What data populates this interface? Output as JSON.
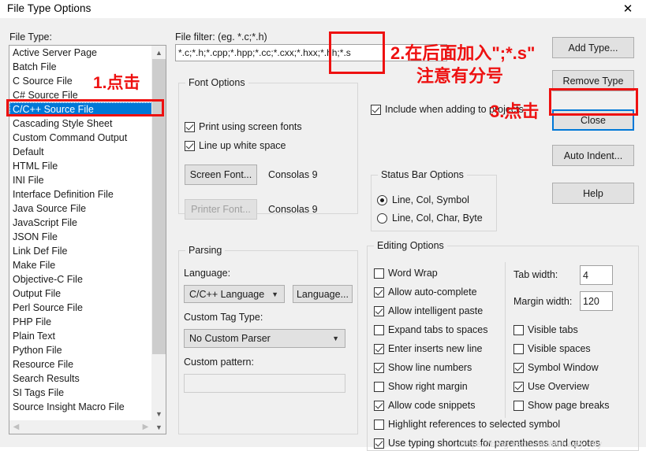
{
  "window": {
    "title": "File Type Options",
    "close_icon": "close-x-icon"
  },
  "filetype": {
    "label": "File Type:",
    "items": [
      "Active Server Page",
      "Batch File",
      "C Source File",
      "C# Source File",
      "C/C++ Source File",
      "Cascading Style Sheet",
      "Custom Command Output",
      "Default",
      "HTML File",
      "INI File",
      "Interface Definition File",
      "Java Source File",
      "JavaScript File",
      "JSON File",
      "Link Def File",
      "Make File",
      "Objective-C File",
      "Output File",
      "Perl Source File",
      "PHP File",
      "Plain Text",
      "Python File",
      "Resource File",
      "Search Results",
      "SI Tags File",
      "Source Insight Macro File"
    ],
    "selected_index": 4,
    "scroll_up_icon": "chevron-up-icon",
    "scroll_down_icon": "chevron-down-icon",
    "scroll_left_icon": "chevron-left-icon",
    "scroll_right_icon": "chevron-right-icon"
  },
  "filefilter": {
    "label": "File filter: (eg. *.c;*.h)",
    "value": "*.c;*.h;*.cpp;*.hpp;*.cc;*.cxx;*.hxx;*.hh;*.s",
    "placeholder": ""
  },
  "font_options": {
    "title": "Font Options",
    "print_using_screen_fonts": {
      "label": "Print using screen fonts",
      "checked": true
    },
    "line_up_white_space": {
      "label": "Line up white space",
      "checked": true
    },
    "screen_font_button": "Screen Font...",
    "screen_font_name": "Consolas 9",
    "printer_font_button": "Printer Font...",
    "printer_font_name": "Consolas 9",
    "printer_font_disabled": true
  },
  "include_checkbox": {
    "label": "Include when adding to projects",
    "checked": true
  },
  "status_bar_options": {
    "title": "Status Bar Options",
    "options": [
      {
        "label": "Line, Col, Symbol",
        "selected": true
      },
      {
        "label": "Line, Col, Char, Byte",
        "selected": false
      }
    ]
  },
  "parsing": {
    "title": "Parsing",
    "language_label": "Language:",
    "language_value": "C/C++ Language",
    "language_button": "Language...",
    "custom_tag_type_label": "Custom Tag Type:",
    "custom_tag_type_value": "No Custom Parser",
    "custom_pattern_label": "Custom pattern:",
    "custom_pattern_value": "",
    "dropdown_icon": "chevron-down-icon"
  },
  "editing_options": {
    "title": "Editing Options",
    "left_column": [
      {
        "label": "Word Wrap",
        "checked": false
      },
      {
        "label": "Allow auto-complete",
        "checked": true
      },
      {
        "label": "Allow intelligent paste",
        "checked": true
      },
      {
        "label": "Expand tabs to spaces",
        "checked": false
      },
      {
        "label": "Enter inserts new line",
        "checked": true
      },
      {
        "label": "Show line numbers",
        "checked": true
      },
      {
        "label": "Show right margin",
        "checked": false
      },
      {
        "label": "Allow code snippets",
        "checked": true
      }
    ],
    "right_column": [
      {
        "label": "Visible tabs",
        "checked": false
      },
      {
        "label": "Visible spaces",
        "checked": false
      },
      {
        "label": "Symbol Window",
        "checked": true
      },
      {
        "label": "Use Overview",
        "checked": true
      },
      {
        "label": "Show page breaks",
        "checked": false
      }
    ],
    "full_width": [
      {
        "label": "Highlight references to selected symbol",
        "checked": false
      },
      {
        "label": "Use typing shortcuts for parentheses and quotes",
        "checked": true
      }
    ],
    "tab_width_label": "Tab width:",
    "tab_width_value": "4",
    "margin_width_label": "Margin width:",
    "margin_width_value": "120"
  },
  "side_buttons": {
    "add_type": "Add Type...",
    "remove_type": "Remove Type",
    "close": "Close",
    "auto_indent": "Auto Indent...",
    "help": "Help"
  },
  "annotations": {
    "step1": "1.点击",
    "step2": "2.在后面加入\";*.s\"",
    "step2_note": "注意有分号",
    "step3": "3.点击",
    "color": "#ee1111"
  },
  "watermark": "https://blog.csdn.net/thisway_diy"
}
